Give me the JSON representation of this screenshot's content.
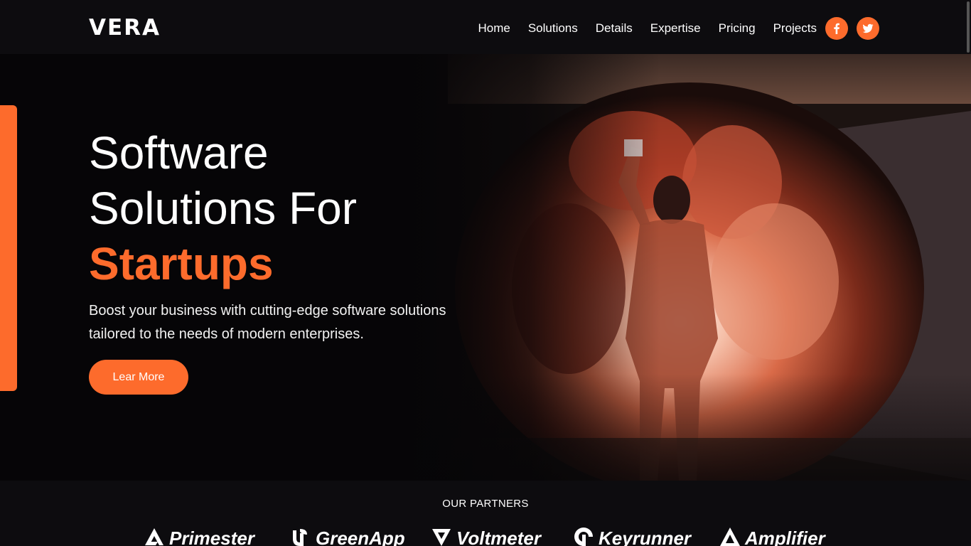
{
  "brand": {
    "name": "VERA"
  },
  "nav": {
    "items": [
      {
        "label": "Home"
      },
      {
        "label": "Solutions"
      },
      {
        "label": "Details"
      },
      {
        "label": "Expertise"
      },
      {
        "label": "Pricing"
      },
      {
        "label": "Projects"
      }
    ],
    "social": [
      {
        "icon": "facebook-icon",
        "glyph": "f"
      },
      {
        "icon": "twitter-icon"
      }
    ]
  },
  "hero": {
    "title_line1": "Software",
    "title_line2": "Solutions For",
    "title_accent": "Startups",
    "description": "Boost your business with cutting-edge software solutions tailored to the needs of modern enterprises.",
    "cta_label": "Lear More",
    "image_subject": "person holding orange smoke flare in a tunnel"
  },
  "partners": {
    "title": "OUR PARTNERS",
    "items": [
      {
        "name": "Primester",
        "icon": "primester-logo-icon"
      },
      {
        "name": "GreenApp",
        "icon": "greenapp-logo-icon"
      },
      {
        "name": "Voltmeter",
        "icon": "voltmeter-logo-icon"
      },
      {
        "name": "Keyrunner",
        "icon": "keyrunner-logo-icon"
      },
      {
        "name": "Amplifier",
        "icon": "amplifier-logo-icon"
      }
    ]
  },
  "colors": {
    "accent": "#fd6b2c",
    "background": "#070608",
    "header": "#0d0c0f",
    "text": "#ffffff"
  }
}
